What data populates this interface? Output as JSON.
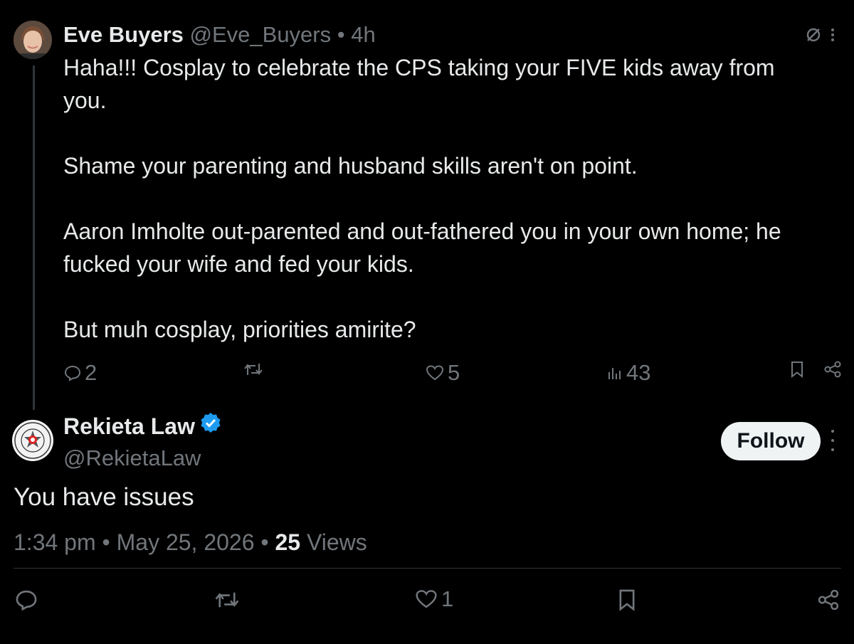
{
  "parent_tweet": {
    "display_name": "Eve Buyers",
    "handle": "@Eve_Buyers",
    "separator": "•",
    "time": "4h",
    "paragraphs": [
      "Haha!!! Cosplay to celebrate the CPS taking your FIVE kids away from you.",
      "Shame your parenting and husband skills aren't on point.",
      "Aaron Imholte out-parented and out-fathered you in your own home; he fucked your wife and fed your kids.",
      "But muh cosplay, priorities amirite?"
    ],
    "replies": "2",
    "likes": "5",
    "views": "43"
  },
  "main_tweet": {
    "display_name": "Rekieta Law",
    "handle": "@RekietaLaw",
    "follow_label": "Follow",
    "text": "You have issues",
    "time": "1:34 pm",
    "separator": "•",
    "date": "May 25, 2026",
    "views_count": "25",
    "views_label": "Views",
    "likes": "1"
  },
  "colors": {
    "background": "#000000",
    "text": "#e7e9ea",
    "muted": "#71767b",
    "verified": "#1d9bf0",
    "follow_bg": "#eff3f4"
  }
}
